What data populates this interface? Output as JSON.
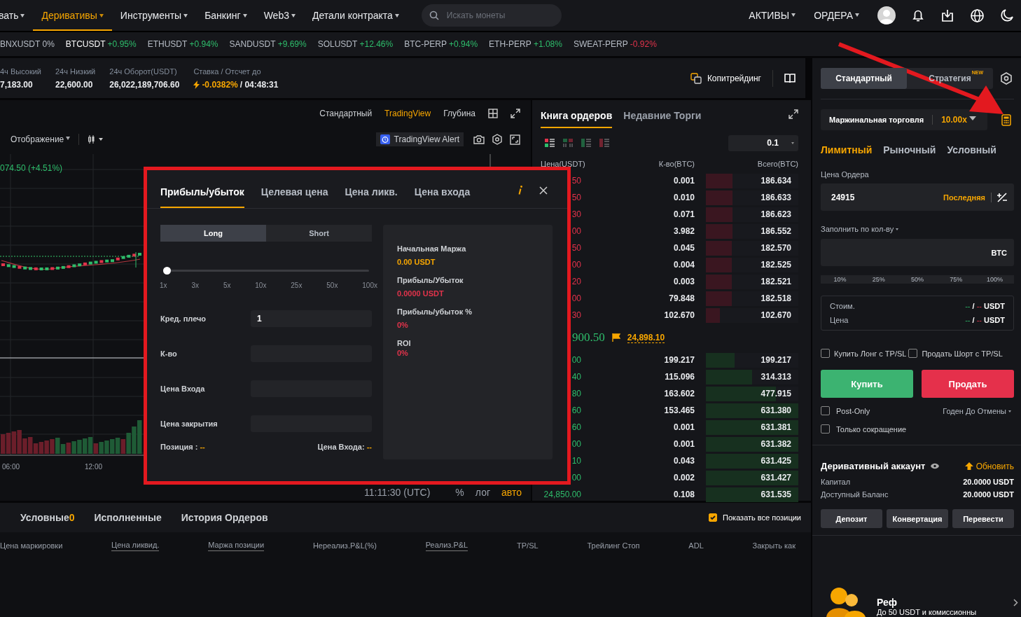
{
  "nav": {
    "items": [
      {
        "label": "вать",
        "selected": false
      },
      {
        "label": "Деривативы",
        "selected": true
      },
      {
        "label": "Инструменты",
        "selected": false
      },
      {
        "label": "Банкинг",
        "selected": false
      },
      {
        "label": "Web3",
        "selected": false
      },
      {
        "label": "Детали контракта",
        "selected": false
      }
    ],
    "search": {
      "placeholder": "Искать монеты"
    },
    "menus": [
      "АКТИВЫ",
      "ОРДЕРА"
    ]
  },
  "ticker": [
    {
      "symbol": "BNXUSDT",
      "change": "0%",
      "color": "#b7bdc6",
      "selected": false
    },
    {
      "symbol": "BTCUSDT",
      "change": "+0.95%",
      "color": "#2ebd6b",
      "selected": true
    },
    {
      "symbol": "ETHUSDT",
      "change": "+0.94%",
      "color": "#2ebd6b",
      "selected": false
    },
    {
      "symbol": "SANDUSDT",
      "change": "+9.69%",
      "color": "#2ebd6b",
      "selected": false
    },
    {
      "symbol": "SOLUSDT",
      "change": "+12.46%",
      "color": "#2ebd6b",
      "selected": false
    },
    {
      "symbol": "BTC-PERP",
      "change": "+0.94%",
      "color": "#2ebd6b",
      "selected": false
    },
    {
      "symbol": "ETH-PERP",
      "change": "+1.08%",
      "color": "#2ebd6b",
      "selected": false
    },
    {
      "symbol": "SWEAT-PERP",
      "change": "-0.92%",
      "color": "#e2334b",
      "selected": false
    }
  ],
  "stats": {
    "items": [
      {
        "label": "4ч Высокий",
        "value": "7,183.00"
      },
      {
        "label": "24ч Низкий",
        "value": "22,600.00"
      },
      {
        "label": "24ч Оборот(USDT)",
        "value": "26,022,189,706.60"
      }
    ],
    "funding": {
      "label": "Ставка / Отсчет до",
      "rate": "-0.0382%",
      "countdown": "/ 04:48:31"
    },
    "copytrading": "Копитрейдинг"
  },
  "chart": {
    "views": [
      {
        "label": "Стандартный",
        "selected": false
      },
      {
        "label": "TradingView",
        "selected": true
      },
      {
        "label": "Глубина",
        "selected": false
      }
    ],
    "display": "Отображение",
    "alert": "TradingView Alert",
    "change": "074.50 (+4.51%)",
    "times": [
      "06:00",
      "12:00"
    ],
    "clock": "11:11:30 (UTC)",
    "scale": [
      {
        "label": "%",
        "selected": false
      },
      {
        "label": "лог",
        "selected": false
      },
      {
        "label": "авто",
        "selected": true
      }
    ]
  },
  "orderbook": {
    "tabs": [
      {
        "label": "Книга ордеров",
        "selected": true
      },
      {
        "label": "Недавние Торги",
        "selected": false
      }
    ],
    "views": [
      {
        "kind": "both",
        "selected": true
      },
      {
        "kind": "columns",
        "selected": false
      },
      {
        "kind": "bids",
        "selected": false
      },
      {
        "kind": "asks",
        "selected": false
      }
    ],
    "step": "0.1",
    "columns": [
      "Цена(USDT)",
      "К-во(BTC)",
      "Всего(BTC)"
    ],
    "asks": [
      {
        "price": "50",
        "qty": "0.001",
        "total": "186.634",
        "level": 0.29
      },
      {
        "price": "50",
        "qty": "0.010",
        "total": "186.633",
        "level": 0.29
      },
      {
        "price": "30",
        "qty": "0.071",
        "total": "186.623",
        "level": 0.29
      },
      {
        "price": "00",
        "qty": "3.982",
        "total": "186.552",
        "level": 0.29
      },
      {
        "price": "50",
        "qty": "0.045",
        "total": "182.570",
        "level": 0.28
      },
      {
        "price": "00",
        "qty": "0.004",
        "total": "182.525",
        "level": 0.28
      },
      {
        "price": "20",
        "qty": "0.003",
        "total": "182.521",
        "level": 0.28
      },
      {
        "price": "00",
        "qty": "79.848",
        "total": "182.518",
        "level": 0.28
      },
      {
        "price": "30",
        "qty": "102.670",
        "total": "102.670",
        "level": 0.15
      }
    ],
    "last": "900.50",
    "mark": "24,898.10",
    "bids": [
      {
        "price": "00",
        "qty": "199.217",
        "total": "199.217",
        "level": 0.31
      },
      {
        "price": "40",
        "qty": "115.096",
        "total": "314.313",
        "level": 0.5
      },
      {
        "price": "80",
        "qty": "163.602",
        "total": "477.915",
        "level": 0.76
      },
      {
        "price": "60",
        "qty": "153.465",
        "total": "631.380",
        "level": 1
      },
      {
        "price": "60",
        "qty": "0.001",
        "total": "631.381",
        "level": 1
      },
      {
        "price": "00",
        "qty": "0.001",
        "total": "631.382",
        "level": 1
      },
      {
        "price": "10",
        "qty": "0.043",
        "total": "631.425",
        "level": 1
      },
      {
        "price": "00",
        "qty": "0.002",
        "total": "631.427",
        "level": 1
      },
      {
        "price": "24,850.00",
        "qty": "0.108",
        "total": "631.535",
        "level": 1
      }
    ]
  },
  "calculator": {
    "tabs": [
      {
        "label": "Прибыль/убыток",
        "selected": true
      },
      {
        "label": "Целевая цена",
        "selected": false
      },
      {
        "label": "Цена ликв.",
        "selected": false
      },
      {
        "label": "Цена входа",
        "selected": false
      }
    ],
    "sides": [
      {
        "label": "Long",
        "selected": true
      },
      {
        "label": "Short",
        "selected": false
      }
    ],
    "leverage": {
      "level": 0,
      "ticks": [
        "1x",
        "3x",
        "5x",
        "10x",
        "25x",
        "50x",
        "100x"
      ]
    },
    "fields": [
      {
        "label": "Кред. плечо",
        "value": "1"
      },
      {
        "label": "К-во"
      },
      {
        "label": "Цена Входа"
      },
      {
        "label": "Цена закрытия"
      }
    ],
    "position": {
      "label": "Позиция :",
      "value": "--"
    },
    "entry": {
      "label": "Цена Входа:",
      "value": "--"
    },
    "results": [
      {
        "label": "Начальная Маржа",
        "value": "0.00 USDT",
        "color": "#f7a600"
      },
      {
        "label": "Прибыль/Убыток",
        "value": "0.0000 USDT",
        "color": "#e2334b"
      },
      {
        "label": "Прибыль/убыток %",
        "value": "0%",
        "color": "#e2334b"
      },
      {
        "label": "ROI",
        "value": "0%",
        "color": "#e2334b"
      }
    ]
  },
  "order_panel": {
    "modes": [
      {
        "label": "Стандартный",
        "selected": true
      },
      {
        "label": "Стратегия",
        "selected": false,
        "badge": "NEW"
      }
    ],
    "margin": {
      "label": "Маржинальная торговля",
      "leverage": "10.00x"
    },
    "types": [
      {
        "label": "Лимитный",
        "selected": true
      },
      {
        "label": "Рыночный",
        "selected": false
      },
      {
        "label": "Условный",
        "selected": false
      }
    ],
    "price": {
      "label": "Цена Ордера",
      "value": "24915",
      "mode": "Последняя"
    },
    "qty": {
      "label": "Заполнить по кол-ву",
      "unit": "BTC"
    },
    "percents": [
      "10%",
      "25%",
      "50%",
      "75%",
      "100%"
    ],
    "summary": [
      {
        "label": "Стоим.",
        "buy": "--",
        "sep": "/",
        "sell": "--",
        "unit": "USDT"
      },
      {
        "label": "Цена",
        "buy": "--",
        "sep": "/",
        "sell": "--",
        "unit": "USDT"
      }
    ],
    "tpsl": [
      {
        "label": "Купить Лонг с TP/SL",
        "checked": false
      },
      {
        "label": "Продать Шорт с TP/SL",
        "checked": false
      }
    ],
    "buy": "Купить",
    "sell": "Продать",
    "post_only": {
      "label": "Post-Only",
      "checked": false
    },
    "tif": "Годен До Отмены",
    "reduce_only": {
      "label": "Только сокращение",
      "checked": false
    },
    "account": {
      "title": "Деривативный аккаунт",
      "refresh": "Обновить",
      "rows": [
        {
          "label": "Капитал",
          "value": "20.0000 USDT"
        },
        {
          "label": "Доступный Баланс",
          "value": "20.0000 USDT"
        }
      ],
      "buttons": [
        "Депозит",
        "Конвертация",
        "Перевести"
      ]
    },
    "promo": {
      "title": "Реф",
      "text": "До 50 USDT и комиссионны"
    }
  },
  "positions": {
    "tabs": [
      {
        "label": "Условные",
        "count": "0",
        "selected": false
      },
      {
        "label": "Исполненные",
        "selected": false
      },
      {
        "label": "История Ордеров",
        "selected": false
      }
    ],
    "show_all": {
      "label": "Показать все позиции",
      "checked": true
    },
    "columns": [
      {
        "label": "Цена маркировки",
        "underlined": false
      },
      {
        "label": "Цена ликвид.",
        "underlined": true
      },
      {
        "label": "Маржа позиции",
        "underlined": true
      },
      {
        "label": "Нереализ.P&L(%)",
        "underlined": false
      },
      {
        "label": "Реализ.P&L",
        "underlined": true
      },
      {
        "label": "TP/SL",
        "underlined": false
      },
      {
        "label": "Трейлинг Стоп",
        "underlined": false
      },
      {
        "label": "ADL",
        "underlined": false
      },
      {
        "label": "Закрыть как",
        "underlined": false
      }
    ]
  }
}
